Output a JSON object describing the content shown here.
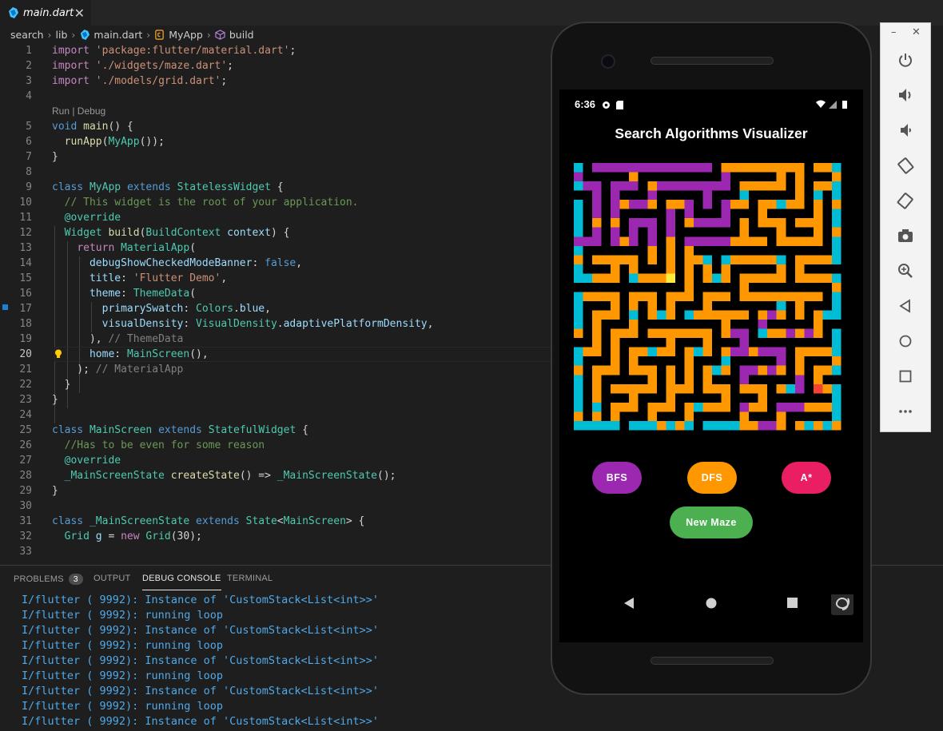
{
  "editor": {
    "tab_label": "main.dart",
    "breadcrumb": [
      "search",
      "lib",
      "main.dart",
      "MyApp",
      "build"
    ]
  },
  "code_lines": [
    {
      "n": "1",
      "html": "<span class=\"kw2\">import</span> <span class=\"str\">'package:flutter/material.dart'</span><span class=\"pl\">;</span>"
    },
    {
      "n": "2",
      "html": "<span class=\"kw2\">import</span> <span class=\"str\">'./widgets/maze.dart'</span><span class=\"pl\">;</span>"
    },
    {
      "n": "3",
      "html": "<span class=\"kw2\">import</span> <span class=\"str\">'./models/grid.dart'</span><span class=\"pl\">;</span>"
    },
    {
      "n": "4",
      "html": ""
    },
    {
      "n": "",
      "html": "<span class=\"codelens\">Run | Debug</span>"
    },
    {
      "n": "5",
      "html": "<span class=\"kw\">void</span> <span class=\"fn\">main</span><span class=\"pl\">() {</span>"
    },
    {
      "n": "6",
      "html": "<span class=\"pl\">  </span><span class=\"fn\">runApp</span><span class=\"pl\">(</span><span class=\"ty\">MyApp</span><span class=\"pl\">());</span>"
    },
    {
      "n": "7",
      "html": "<span class=\"pl\">}</span>"
    },
    {
      "n": "8",
      "html": ""
    },
    {
      "n": "9",
      "html": "<span class=\"kw\">class</span> <span class=\"ty\">MyApp</span> <span class=\"kw\">extends</span> <span class=\"ty\">StatelessWidget</span> <span class=\"pl\">{</span>"
    },
    {
      "n": "10",
      "html": "<span class=\"cm\">  // This widget is the root of your application.</span>"
    },
    {
      "n": "11",
      "html": "<span class=\"pl\">  </span><span class=\"ty\">@override</span>"
    },
    {
      "n": "12",
      "html": "<span class=\"pl\">  </span><span class=\"ty\">Widget</span> <span class=\"fn\">build</span><span class=\"pl\">(</span><span class=\"ty\">BuildContext</span> <span class=\"var\">context</span><span class=\"pl\">) {</span>"
    },
    {
      "n": "13",
      "html": "<span class=\"pl\">    </span><span class=\"kw2\">return</span> <span class=\"ty\">MaterialApp</span><span class=\"pl\">(</span>"
    },
    {
      "n": "14",
      "html": "<span class=\"pl\">      </span><span class=\"var\">debugShowCheckedModeBanner</span><span class=\"pl\">: </span><span class=\"kw\">false</span><span class=\"pl\">,</span>"
    },
    {
      "n": "15",
      "html": "<span class=\"pl\">      </span><span class=\"var\">title</span><span class=\"pl\">: </span><span class=\"str\">'Flutter Demo'</span><span class=\"pl\">,</span>"
    },
    {
      "n": "16",
      "html": "<span class=\"pl\">      </span><span class=\"var\">theme</span><span class=\"pl\">: </span><span class=\"ty\">ThemeData</span><span class=\"pl\">(</span>"
    },
    {
      "n": "17",
      "html": "<span class=\"pl\">        </span><span class=\"var\">primarySwatch</span><span class=\"pl\">: </span><span class=\"ty\">Colors</span><span class=\"pl\">.</span><span class=\"var\">blue</span><span class=\"pl\">,</span>"
    },
    {
      "n": "18",
      "html": "<span class=\"pl\">        </span><span class=\"var\">visualDensity</span><span class=\"pl\">: </span><span class=\"ty\">VisualDensity</span><span class=\"pl\">.</span><span class=\"var\">adaptivePlatformDensity</span><span class=\"pl\">,</span>"
    },
    {
      "n": "19",
      "html": "<span class=\"pl\">      ), </span><span class=\"cmg\">// ThemeData</span>"
    },
    {
      "n": "20",
      "html": "<span class=\"pl\">      </span><span class=\"var\">home</span><span class=\"pl\">: </span><span class=\"ty\">MainScreen</span><span class=\"pl\">(),</span>"
    },
    {
      "n": "21",
      "html": "<span class=\"pl\">    ); </span><span class=\"cmg\">// MaterialApp</span>"
    },
    {
      "n": "22",
      "html": "<span class=\"pl\">  }</span>"
    },
    {
      "n": "23",
      "html": "<span class=\"pl\">}</span>"
    },
    {
      "n": "24",
      "html": ""
    },
    {
      "n": "25",
      "html": "<span class=\"kw\">class</span> <span class=\"ty\">MainScreen</span> <span class=\"kw\">extends</span> <span class=\"ty\">StatefulWidget</span> <span class=\"pl\">{</span>"
    },
    {
      "n": "26",
      "html": "<span class=\"cm\">  //Has to be even for some reason</span>"
    },
    {
      "n": "27",
      "html": "<span class=\"pl\">  </span><span class=\"ty\">@override</span>"
    },
    {
      "n": "28",
      "html": "<span class=\"pl\">  </span><span class=\"ty\">_MainScreenState</span> <span class=\"fn\">createState</span><span class=\"pl\">() =&gt; </span><span class=\"ty\">_MainScreenState</span><span class=\"pl\">();</span>"
    },
    {
      "n": "29",
      "html": "<span class=\"pl\">}</span>"
    },
    {
      "n": "30",
      "html": ""
    },
    {
      "n": "31",
      "html": "<span class=\"kw\">class</span> <span class=\"ty\">_MainScreenState</span> <span class=\"kw\">extends</span> <span class=\"ty\">State</span><span class=\"pl\">&lt;</span><span class=\"ty\">MainScreen</span><span class=\"pl\">&gt; {</span>"
    },
    {
      "n": "32",
      "html": "<span class=\"pl\">  </span><span class=\"ty\">Grid</span> <span class=\"var\">g</span><span class=\"pl\"> = </span><span class=\"kw2\">new</span> <span class=\"ty\">Grid</span><span class=\"pl\">(30);</span>"
    },
    {
      "n": "33",
      "html": ""
    }
  ],
  "panel": {
    "tabs": [
      "PROBLEMS",
      "OUTPUT",
      "DEBUG CONSOLE",
      "TERMINAL"
    ],
    "problems_count": "3",
    "active_tab": "DEBUG CONSOLE",
    "console_lines": [
      "I/flutter ( 9992): Instance of 'CustomStack<List<int>>'",
      "I/flutter ( 9992): running loop",
      "I/flutter ( 9992): Instance of 'CustomStack<List<int>>'",
      "I/flutter ( 9992): running loop",
      "I/flutter ( 9992): Instance of 'CustomStack<List<int>>'",
      "I/flutter ( 9992): running loop",
      "I/flutter ( 9992): Instance of 'CustomStack<List<int>>'",
      "I/flutter ( 9992): running loop",
      "I/flutter ( 9992): Instance of 'CustomStack<List<int>>'"
    ]
  },
  "phone": {
    "status_time": "6:36",
    "app_title": "Search Algorithms Visualizer",
    "buttons": {
      "bfs": {
        "label": "BFS",
        "color": "#9c27b0"
      },
      "dfs": {
        "label": "DFS",
        "color": "#ff9800"
      },
      "astar": {
        "label": "A*",
        "color": "#e91e63"
      },
      "new_maze": {
        "label": "New Maze",
        "color": "#4caf50"
      }
    },
    "maze": {
      "legend_colors": {
        "wall": "#000000",
        "bfs": "#9c27b0",
        "dfs": "#ff9800",
        "open": "#00bcd4",
        "start": "#ffeb3b",
        "end": "#f44336"
      }
    },
    "nav_icons": [
      "back-icon",
      "home-icon",
      "recents-icon",
      "rotate-icon"
    ]
  },
  "emulator_toolbar": {
    "icons": [
      "power-icon",
      "volume-up-icon",
      "volume-down-icon",
      "rotate-left-icon",
      "rotate-right-icon",
      "camera-icon",
      "zoom-icon",
      "back-icon",
      "home-icon",
      "overview-icon",
      "more-icon"
    ]
  }
}
